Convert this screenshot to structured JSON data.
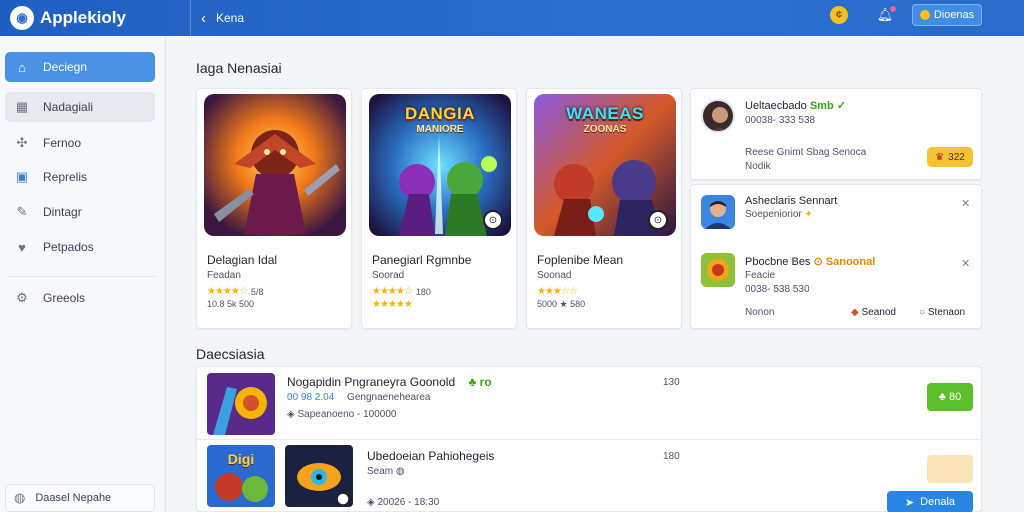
{
  "app": {
    "name": "Applekioly",
    "logo_icon": "mascot-logo-icon"
  },
  "topbar": {
    "back_icon": "back-chevron-icon",
    "breadcrumb": "Kena",
    "coin_icon": "coin-icon",
    "bell_icon": "bell-icon",
    "button_label": "Dioenas"
  },
  "sidebar": {
    "items": [
      {
        "label": "Deciegn",
        "icon": "home-icon",
        "state": "active"
      },
      {
        "label": "Nadagiali",
        "icon": "grid-icon",
        "state": "hover"
      },
      {
        "label": "Fernoo",
        "icon": "games-icon",
        "state": "normal"
      },
      {
        "label": "Reprelis",
        "icon": "library-icon",
        "state": "normal"
      },
      {
        "label": "Dintagr",
        "icon": "pencil-icon",
        "state": "normal"
      },
      {
        "label": "Petpados",
        "icon": "heart-icon",
        "state": "normal"
      },
      {
        "label": "Greeols",
        "icon": "settings-icon",
        "state": "normal"
      }
    ],
    "footer_label": "Daasel Nepahe",
    "footer_icon": "user-circle-icon"
  },
  "featured": {
    "title": "Iaga Nenasiai",
    "cards": [
      {
        "name": "Delagian Idal",
        "subtitle": "Feadan",
        "rating_text": "5/8",
        "meta": "10.8 5k 500",
        "art": {
          "title": "",
          "subtitle": "",
          "palette": [
            "#f6a21b",
            "#b53a12",
            "#3a1a40"
          ]
        }
      },
      {
        "name": "Panegiarl Rgmnbe",
        "subtitle": "Soorad",
        "rating_text": "180",
        "meta": "",
        "art": {
          "title": "DANGIA",
          "subtitle": "MANIORE",
          "palette": [
            "#2bb7e8",
            "#3d2a7a",
            "#6ad94b"
          ]
        }
      },
      {
        "name": "Foplenibe Mean",
        "subtitle": "Soonad",
        "rating_text": "",
        "meta": "5000 ★ 580",
        "art": {
          "title": "WANEAS",
          "subtitle": "ZOONAS",
          "palette": [
            "#7a4bd0",
            "#d2502b",
            "#3ad0c8"
          ]
        }
      }
    ],
    "star_icon": "star-icon"
  },
  "side_panel": {
    "card1": {
      "name": "Ueltaecbado",
      "tag": "Smb",
      "check": "✓",
      "stats": "00038- 333 538",
      "description": "Reese Gnimt Sbag Senoca",
      "description2": "Nodik",
      "pill": "322",
      "pill_icon": "crown-icon"
    },
    "card2": {
      "entries": [
        {
          "name": "Asheclaris Sennart",
          "subtitle": "Soepeniorior",
          "meta": "",
          "close_icon": "close-icon"
        },
        {
          "name": "Pbocbne Bes",
          "tag": "Sanoonal",
          "subtitle": "Feacie",
          "meta": "0038- 538 530",
          "close_icon": "close-icon"
        }
      ],
      "footer_label": "Nonon",
      "link1": "Seanod",
      "link2": "Stenaon"
    }
  },
  "list": {
    "title": "Daecsiasia",
    "rows": [
      {
        "title": "Nogapidin Pngraneyra Goonold",
        "tag": "♣ ro",
        "stats_a": "00 98 2.04",
        "stats_b": "Gengnaenehearea",
        "meta": "Sapeanoeno - 100000",
        "number": "130",
        "button": "♣ 80",
        "button_state": "enabled"
      },
      {
        "title": "Ubedoeian Pahiohegeis",
        "subtitle": "Seam",
        "meta": "20026 - 18:30",
        "number": "180",
        "button": "",
        "button_state": "disabled",
        "thumb_title": "Digi",
        "action_label": "Denala"
      }
    ]
  },
  "colors": {
    "accent": "#2c6fd0",
    "active_nav": "#4b92e7",
    "gold": "#f4b400",
    "green": "#5cbf2a",
    "cta_blue": "#2a86e4"
  }
}
